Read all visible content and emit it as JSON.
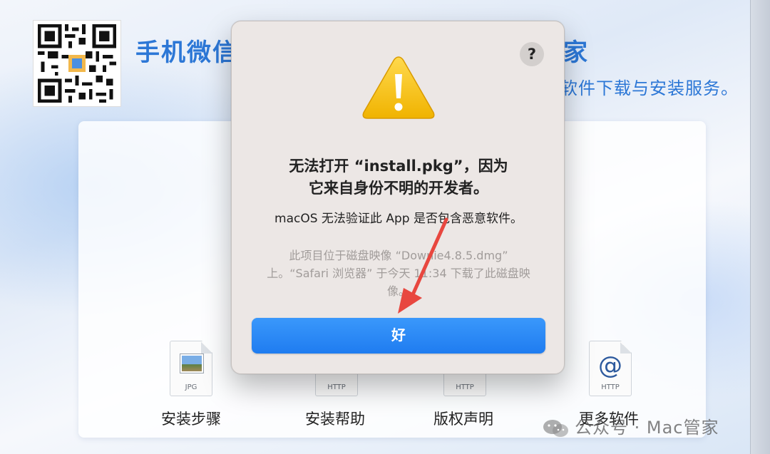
{
  "header": {
    "title_visible": "手机微信",
    "title_tail": "家",
    "subtitle_tail": "软件下载与安装服务。"
  },
  "items": [
    {
      "label": "安装步骤",
      "ext": "JPG",
      "icon": "jpg-file-icon"
    },
    {
      "label": "安装帮助",
      "ext": "HTTP",
      "icon": "http-file-icon"
    },
    {
      "label": "版权声明",
      "ext": "HTTP",
      "icon": "http-file-icon"
    },
    {
      "label": "更多软件",
      "ext": "HTTP",
      "icon": "http-at-file-icon"
    }
  ],
  "dialog": {
    "help_label": "?",
    "title_line1": "无法打开 “install.pkg”，因为",
    "title_line2": "它来自身份不明的开发者。",
    "message": "macOS 无法验证此 App 是否包含恶意软件。",
    "detail": "此项目位于磁盘映像 “Downie4.8.5.dmg” 上。“Safari 浏览器” 于今天 11:34 下载了此磁盘映像。",
    "ok_label": "好"
  },
  "watermark": "公众号 · Mac管家",
  "colors": {
    "accent_blue": "#2c77d6",
    "button_blue": "#1f7cf0",
    "arrow_red": "#e8473f",
    "dialog_bg": "#ece7e5"
  }
}
